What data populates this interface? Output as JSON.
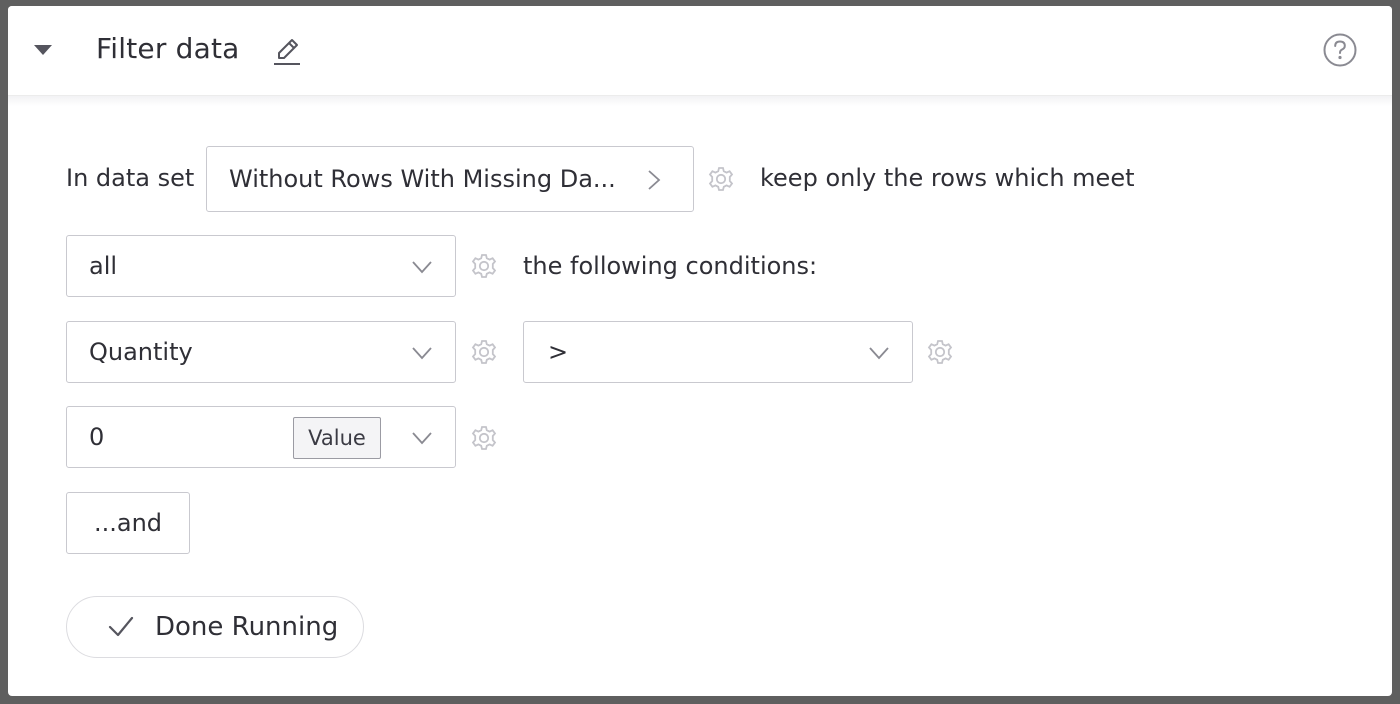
{
  "header": {
    "title": "Filter data"
  },
  "row1": {
    "prefix": "In data set",
    "dataset_value": "Without Rows With Missing Da...",
    "suffix": "keep only the rows which meet"
  },
  "row2": {
    "match_value": "all",
    "suffix": "the following conditions:"
  },
  "condition": {
    "column_value": "Quantity",
    "operator_value": ">",
    "compare_value": "0",
    "value_tag": "Value"
  },
  "buttons": {
    "and_label": "...and",
    "done_label": "Done Running"
  },
  "colors": {
    "icon": "#6e6e78",
    "gear": "#c4c4ca",
    "text": "#2f2f36",
    "border": "#c9c9cf"
  },
  "icons": [
    "triangle-down-icon",
    "pencil-icon",
    "help-circle-icon",
    "chevron-right-icon",
    "chevron-down-icon",
    "gear-icon",
    "checkmark-icon"
  ]
}
